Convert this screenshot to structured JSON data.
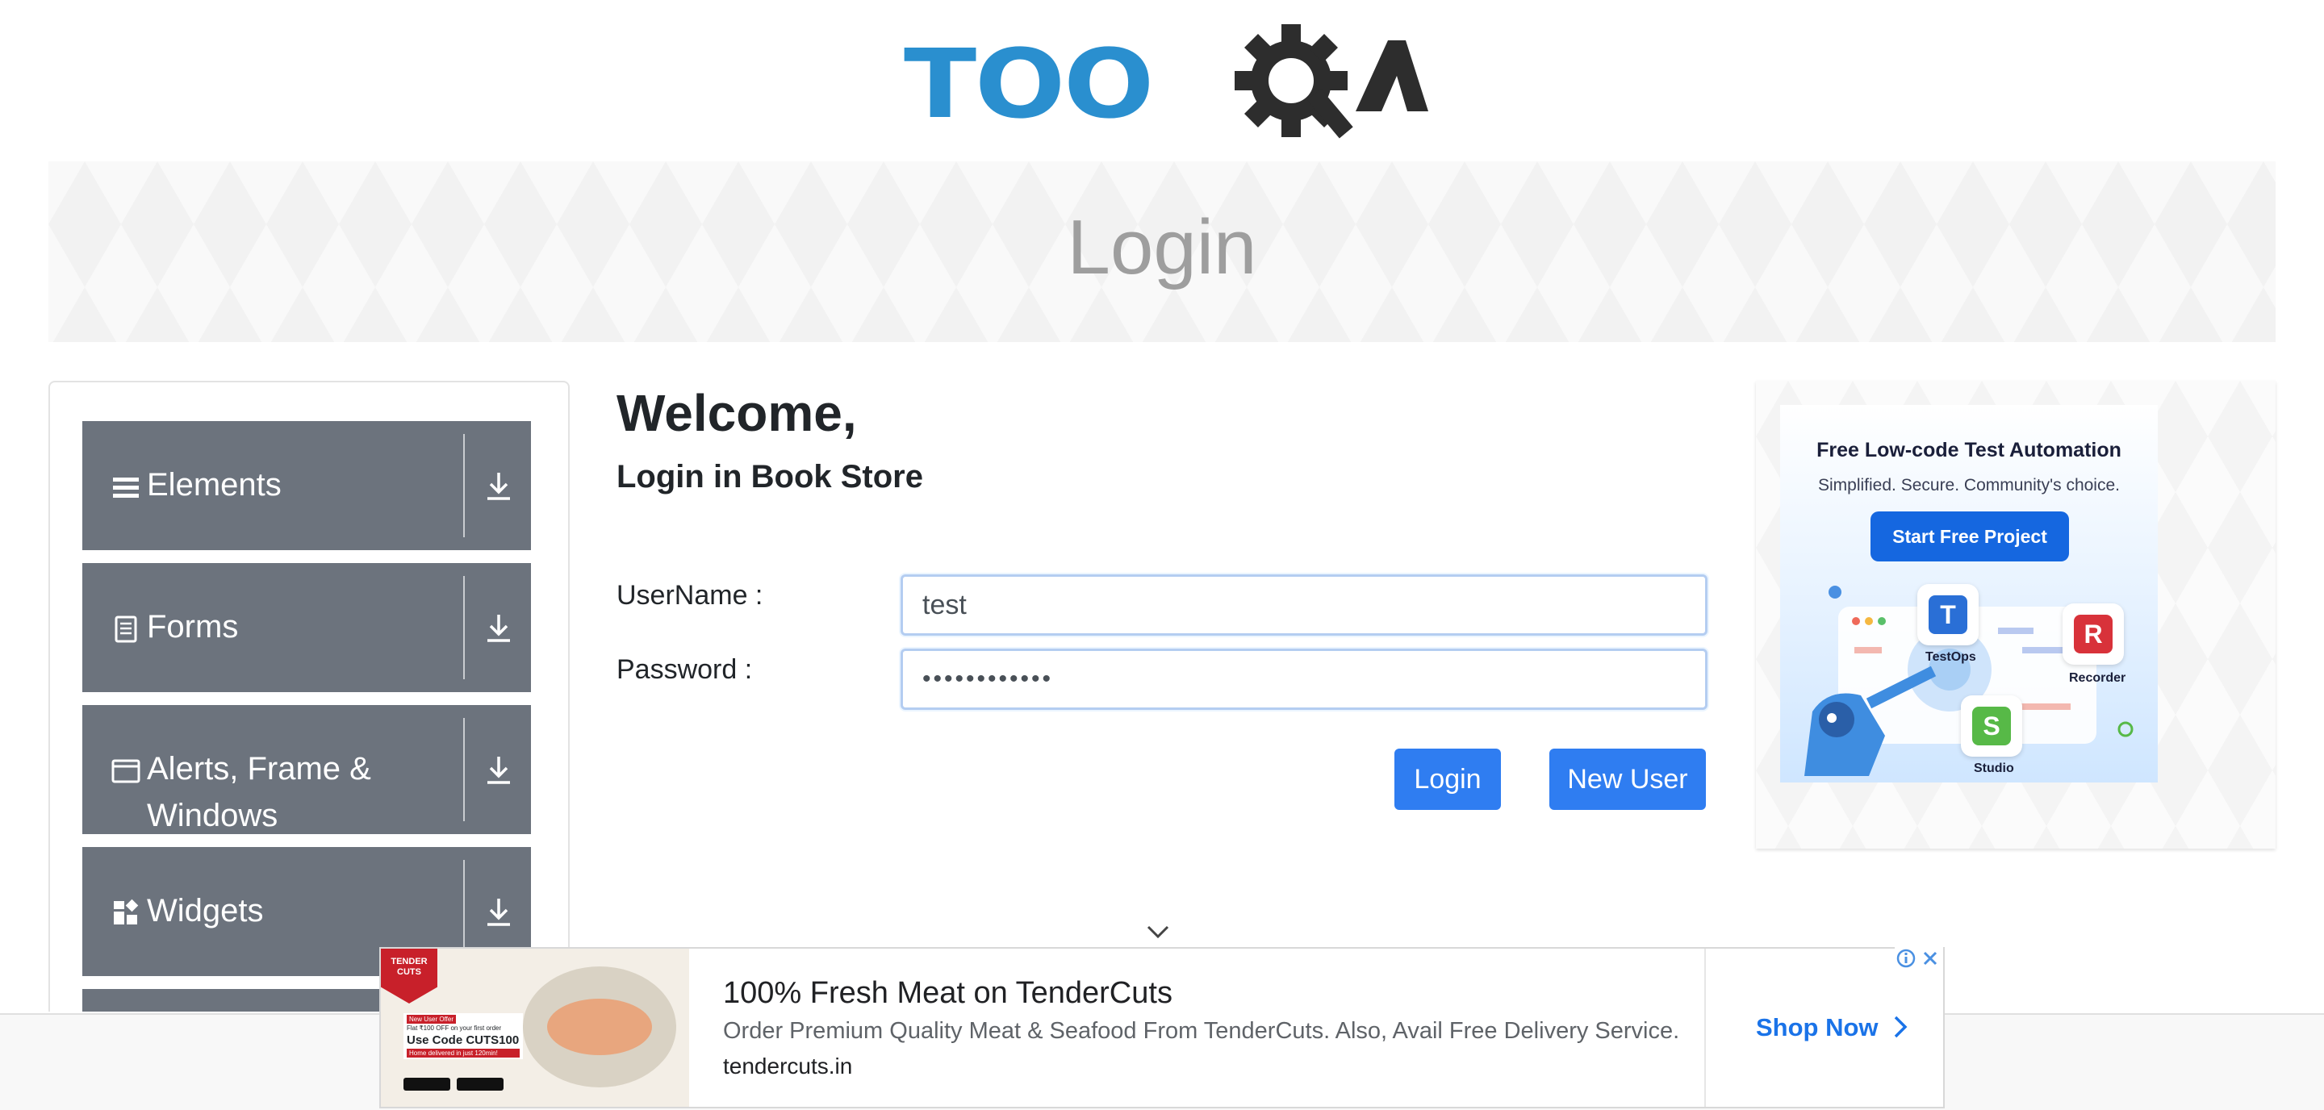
{
  "header": {
    "logo_text": "TOOLSQA"
  },
  "banner": {
    "title": "Login"
  },
  "sidebar": {
    "groups": [
      {
        "label": "Elements",
        "icon": "hamburger-icon"
      },
      {
        "label": "Forms",
        "icon": "document-icon"
      },
      {
        "label": "Alerts, Frame &",
        "label2": "Windows",
        "icon": "window-icon"
      },
      {
        "label": "Widgets",
        "icon": "widgets-icon"
      }
    ]
  },
  "main": {
    "welcome": "Welcome,",
    "subtitle": "Login in Book Store",
    "username_label": "UserName :",
    "username_value": "test",
    "password_label": "Password :",
    "password_value": "••••••••••••",
    "login_button": "Login",
    "new_user_button": "New User"
  },
  "side_ad": {
    "title": "Free Low-code Test Automation",
    "subtitle": "Simplified. Secure. Community's choice.",
    "cta": "Start Free Project",
    "products": [
      "TestOps",
      "Recorder",
      "Studio"
    ],
    "colors": {
      "testops": "#2a6fd6",
      "recorder": "#d8323a",
      "studio": "#57b947"
    }
  },
  "bottom_ad": {
    "brand_lines": [
      "TENDER",
      "CUTS"
    ],
    "promo_small": "New User Offer",
    "promo_line": "Flat ₹100 OFF on your first order",
    "promo_code": "Use Code CUTS100",
    "promo_delivery": "Home delivered in just 120min!",
    "title": "100% Fresh Meat on TenderCuts",
    "description": "Order Premium Quality Meat & Seafood From TenderCuts. Also, Avail Free Delivery Service.",
    "url": "tendercuts.in",
    "cta": "Shop Now"
  }
}
